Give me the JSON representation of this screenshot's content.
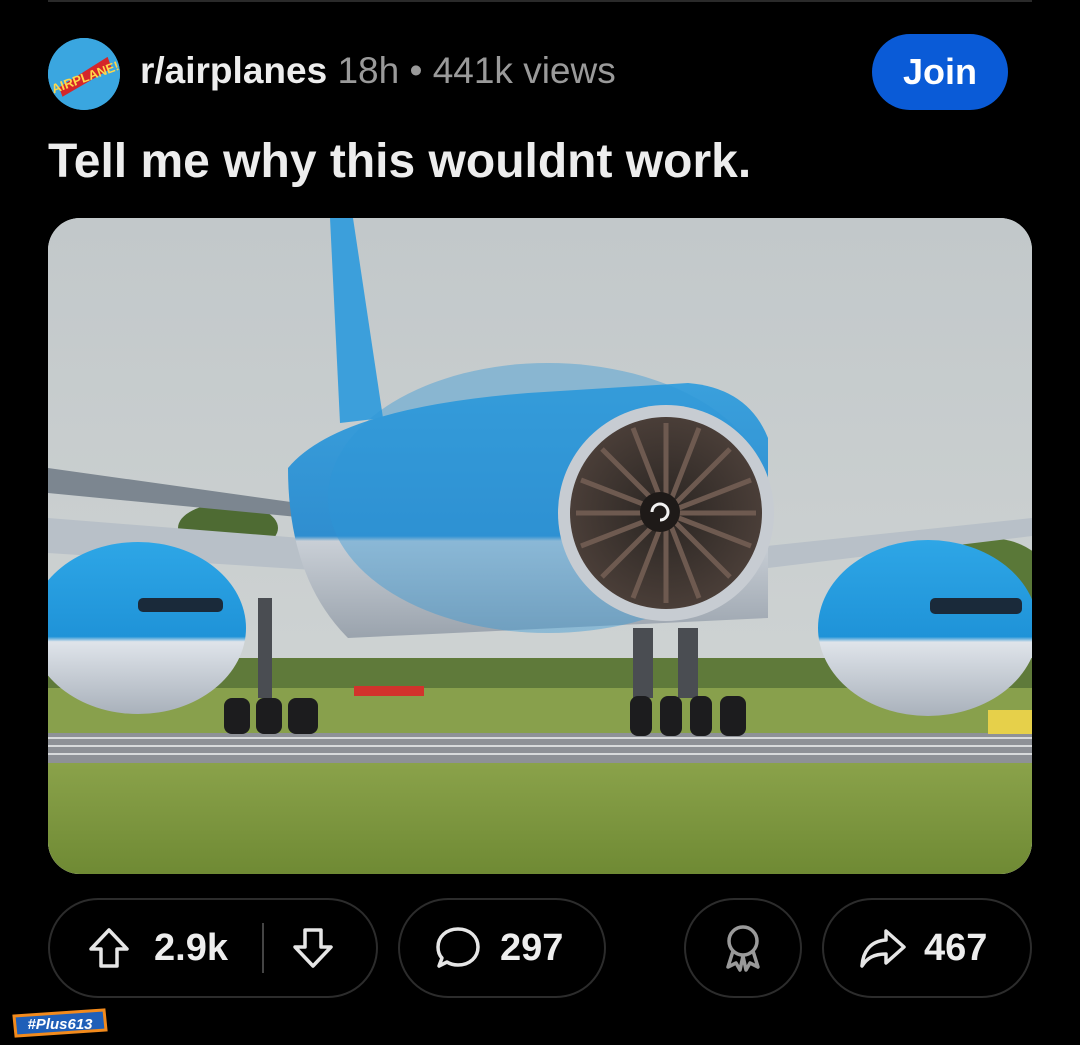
{
  "post": {
    "subreddit": "r/airplanes",
    "age": "18h",
    "separator": "•",
    "views": "441k views",
    "join_label": "Join",
    "title": "Tell me why this wouldnt work.",
    "avatar_text": "AIRPLANE!"
  },
  "actions": {
    "upvotes": "2.9k",
    "comments": "297",
    "shares": "467"
  },
  "watermark": "#Plus613",
  "colors": {
    "background": "#000000",
    "join_button": "#0a5bd7",
    "avatar_bg": "#3aa6e0"
  }
}
